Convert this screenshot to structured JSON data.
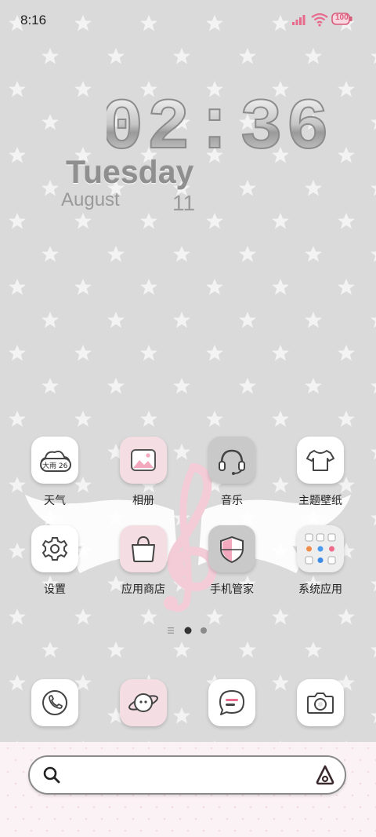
{
  "status_bar": {
    "time": "8:16",
    "battery": "100",
    "accent_color": "#e86a8c"
  },
  "clock_widget": {
    "time": "02:36",
    "weekday": "Tuesday",
    "month": "August",
    "day": "11"
  },
  "apps": [
    {
      "label": "天气",
      "icon": "weather-icon",
      "badge": "大雨 26"
    },
    {
      "label": "相册",
      "icon": "gallery-icon"
    },
    {
      "label": "音乐",
      "icon": "music-headphones-icon"
    },
    {
      "label": "主题壁纸",
      "icon": "theme-shirt-icon"
    },
    {
      "label": "设置",
      "icon": "settings-gear-icon"
    },
    {
      "label": "应用商店",
      "icon": "app-store-bag-icon"
    },
    {
      "label": "手机管家",
      "icon": "phone-manager-shield-icon"
    },
    {
      "label": "系统应用",
      "icon": "system-apps-folder-icon"
    }
  ],
  "page_indicator": {
    "pages": 2,
    "current": 1
  },
  "dock": [
    {
      "icon": "phone-icon"
    },
    {
      "icon": "browser-planet-icon"
    },
    {
      "icon": "messages-icon"
    },
    {
      "icon": "camera-icon"
    }
  ],
  "search_bar": {
    "icon_left": "search-icon",
    "icon_right": "voice-assistant-icon"
  }
}
